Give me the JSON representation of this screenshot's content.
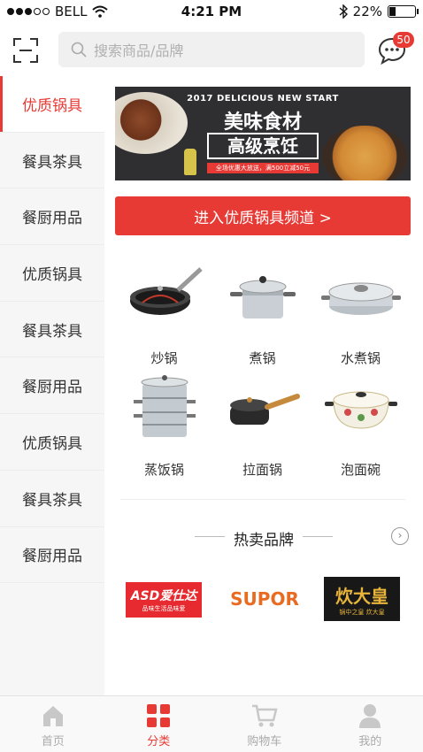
{
  "status_bar": {
    "carrier": "BELL",
    "time": "4:21 PM",
    "battery": "22%",
    "battery_level": 0.22
  },
  "header": {
    "search_placeholder": "搜索商品/品牌",
    "message_badge": "50"
  },
  "sidebar": {
    "items": [
      {
        "label": "优质锅具",
        "active": true
      },
      {
        "label": "餐具茶具",
        "active": false
      },
      {
        "label": "餐厨用品",
        "active": false
      },
      {
        "label": "优质锅具",
        "active": false
      },
      {
        "label": "餐具茶具",
        "active": false
      },
      {
        "label": "餐厨用品",
        "active": false
      },
      {
        "label": "优质锅具",
        "active": false
      },
      {
        "label": "餐具茶具",
        "active": false
      },
      {
        "label": "餐厨用品",
        "active": false
      }
    ]
  },
  "banner": {
    "subtitle": "2017 DELICIOUS NEW START",
    "title": "美味食材",
    "bracket_text": "高级烹饪",
    "promo": "全场优惠大放送，满500立减50元"
  },
  "enter_button": "进入优质锅具频道 >",
  "products": [
    {
      "label": "炒锅",
      "icon": "wok-icon"
    },
    {
      "label": "煮锅",
      "icon": "stockpot-icon"
    },
    {
      "label": "水煮锅",
      "icon": "casserole-icon"
    },
    {
      "label": "蒸饭锅",
      "icon": "steamer-icon"
    },
    {
      "label": "拉面锅",
      "icon": "saucepan-icon"
    },
    {
      "label": "泡面碗",
      "icon": "enamel-pot-icon"
    }
  ],
  "hot_brands": {
    "title": "热卖品牌",
    "brands": [
      {
        "name": "ASD爱仕达",
        "tagline": "品味生活品味爱"
      },
      {
        "name": "SUPOR"
      },
      {
        "name": "炊大皇",
        "tagline": "锅中之皇 炊大皇"
      }
    ]
  },
  "tabbar": {
    "tabs": [
      {
        "label": "首页",
        "icon": "home-icon",
        "active": false
      },
      {
        "label": "分类",
        "icon": "category-icon",
        "active": true
      },
      {
        "label": "购物车",
        "icon": "cart-icon",
        "active": false
      },
      {
        "label": "我的",
        "icon": "user-icon",
        "active": false
      }
    ]
  },
  "colors": {
    "accent": "#e83a35",
    "sidebar_bg": "#f6f6f6"
  }
}
